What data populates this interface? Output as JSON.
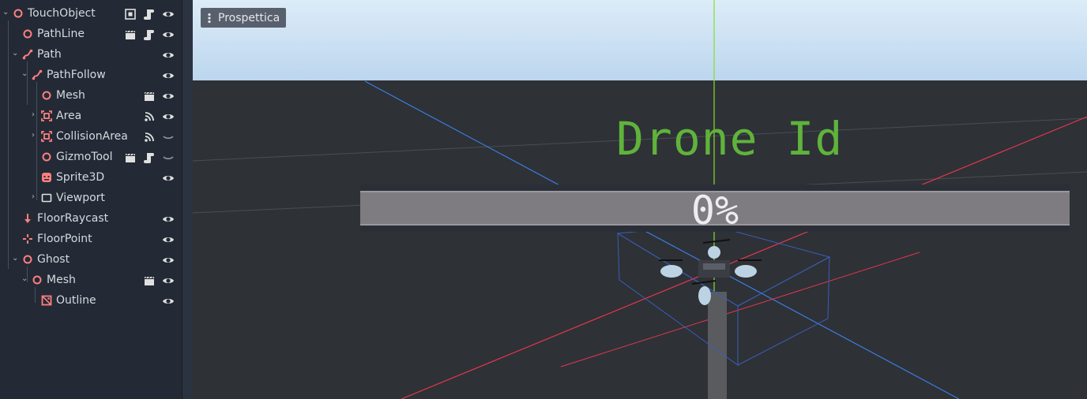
{
  "scene_tree": {
    "nodes": [
      {
        "label": "TouchObject",
        "icon": "spatial-node-icon",
        "expanded": true
      },
      {
        "label": "PathLine",
        "icon": "spatial-node-icon"
      },
      {
        "label": "Path",
        "icon": "path-icon",
        "expanded": true
      },
      {
        "label": "PathFollow",
        "icon": "path-follow-icon",
        "expanded": true
      },
      {
        "label": "Mesh",
        "icon": "spatial-node-icon"
      },
      {
        "label": "Area",
        "icon": "area-icon",
        "expanded": false
      },
      {
        "label": "CollisionArea",
        "icon": "area-icon",
        "expanded": false
      },
      {
        "label": "GizmoTool",
        "icon": "spatial-node-icon"
      },
      {
        "label": "Sprite3D",
        "icon": "sprite3d-icon"
      },
      {
        "label": "Viewport",
        "icon": "viewport-icon",
        "expanded": false
      },
      {
        "label": "FloorRaycast",
        "icon": "raycast-icon"
      },
      {
        "label": "FloorPoint",
        "icon": "position3d-icon"
      },
      {
        "label": "Ghost",
        "icon": "spatial-node-icon",
        "expanded": true
      },
      {
        "label": "Mesh",
        "icon": "spatial-node-icon"
      },
      {
        "label": "Outline",
        "icon": "mesh-instance-icon"
      }
    ]
  },
  "viewport": {
    "view_mode_label": "Prospettica",
    "drone_label": "Drone Id",
    "progress": {
      "value": 0,
      "text": "0%"
    }
  },
  "colors": {
    "node_icon": "#fc7f7f",
    "drone_label": "#5fb33b",
    "sky_top": "#dcecf8",
    "sky_bottom": "#bcd6ee",
    "ground": "#2e3136",
    "axis_x": "#e2374e",
    "axis_y": "#8cdc2a",
    "axis_z": "#3a7de0"
  }
}
